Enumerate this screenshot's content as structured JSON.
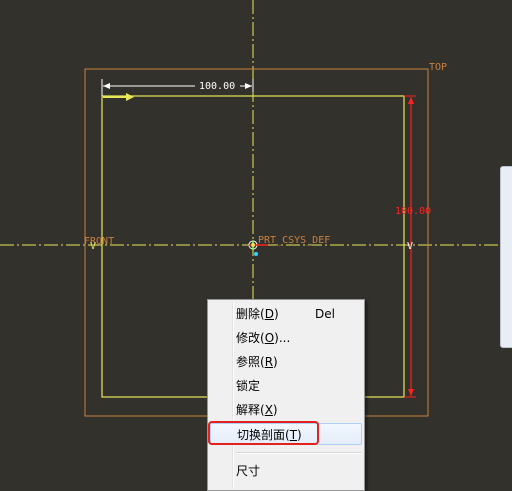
{
  "sketch": {
    "top_label": "TOP",
    "front_label": "FRONT",
    "csys_label": "PRT_CSYS_DEF",
    "dim_horizontal": "100.00",
    "dim_vertical": "100.00",
    "v_marker": "V"
  },
  "context_menu": {
    "items": [
      {
        "text": "删除(",
        "mnemonic": "D",
        "suffix": ")",
        "accel": "Del"
      },
      {
        "text": "修改(",
        "mnemonic": "O",
        "suffix": ")..."
      },
      {
        "text": "参照(",
        "mnemonic": "R",
        "suffix": ")"
      },
      {
        "text": "锁定"
      },
      {
        "text": "解释(",
        "mnemonic": "X",
        "suffix": ")"
      },
      {
        "text": "切换剖面(",
        "mnemonic": "T",
        "suffix": ")"
      },
      {
        "text": "尺寸"
      }
    ],
    "highlighted_index": 5
  },
  "colors": {
    "background": "#33312c",
    "sketch_line": "#e8e85a",
    "datum_plane": "#c9813f",
    "dimension": "#ffffff",
    "constraint": "#ff2020",
    "annotation_box": "#e3221d"
  }
}
